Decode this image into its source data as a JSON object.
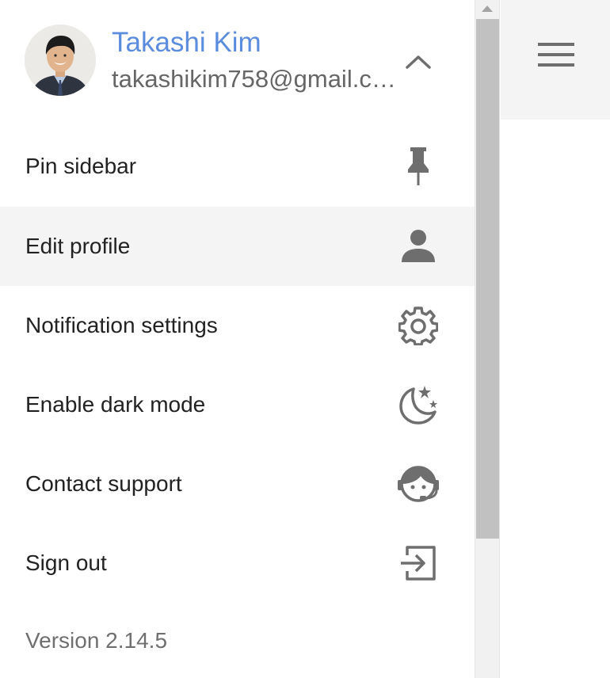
{
  "user": {
    "name": "Takashi Kim",
    "email": "takashikim758@gmail.com"
  },
  "header": {
    "collapse_icon": "chevron-up-icon"
  },
  "menu": {
    "items": [
      {
        "label": "Pin sidebar",
        "icon": "pin-icon"
      },
      {
        "label": "Edit profile",
        "icon": "person-icon"
      },
      {
        "label": "Notification settings",
        "icon": "gear-icon"
      },
      {
        "label": "Enable dark mode",
        "icon": "moon-stars-icon"
      },
      {
        "label": "Contact support",
        "icon": "support-agent-icon"
      },
      {
        "label": "Sign out",
        "icon": "sign-out-icon"
      }
    ]
  },
  "version": "Version 2.14.5",
  "colors": {
    "accent": "#5b8cdd",
    "icon": "#6e6e6e",
    "hover_bg": "#f4f4f4"
  }
}
